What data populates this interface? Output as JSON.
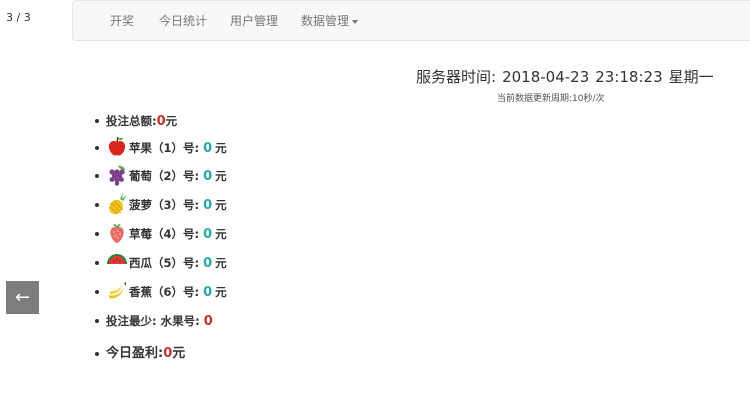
{
  "counter": "3 / 3",
  "nav": {
    "items": [
      "开奖",
      "今日统计",
      "用户管理",
      "数据管理"
    ]
  },
  "server": {
    "label": "服务器时间:",
    "date": "2018-04-23",
    "time": "23:18:23",
    "weekday": "星期一",
    "update_label": "当前数据更新周期:",
    "update_value": "10秒/次"
  },
  "stats": {
    "total_label": "投注总额:",
    "total_value": "0",
    "total_unit": "元",
    "fruits": [
      {
        "icon": "apple-icon",
        "label": "苹果（1）号:",
        "value": "0",
        "unit": "元"
      },
      {
        "icon": "grape-icon",
        "label": "葡萄（2）号:",
        "value": "0",
        "unit": "元"
      },
      {
        "icon": "pineapple-icon",
        "label": "菠萝（3）号:",
        "value": "0",
        "unit": "元"
      },
      {
        "icon": "strawberry-icon",
        "label": "草莓（4）号:",
        "value": "0",
        "unit": "元"
      },
      {
        "icon": "watermelon-icon",
        "label": "西瓜（5）号:",
        "value": "0",
        "unit": "元"
      },
      {
        "icon": "banana-icon",
        "label": "香蕉（6）号:",
        "value": "0",
        "unit": "元"
      }
    ],
    "least_label": "投注最少: 水果号:",
    "least_value": "0",
    "profit_label": "今日盈利:",
    "profit_value": "0",
    "profit_unit": "元"
  },
  "prev_icon": "arrow-left-icon"
}
